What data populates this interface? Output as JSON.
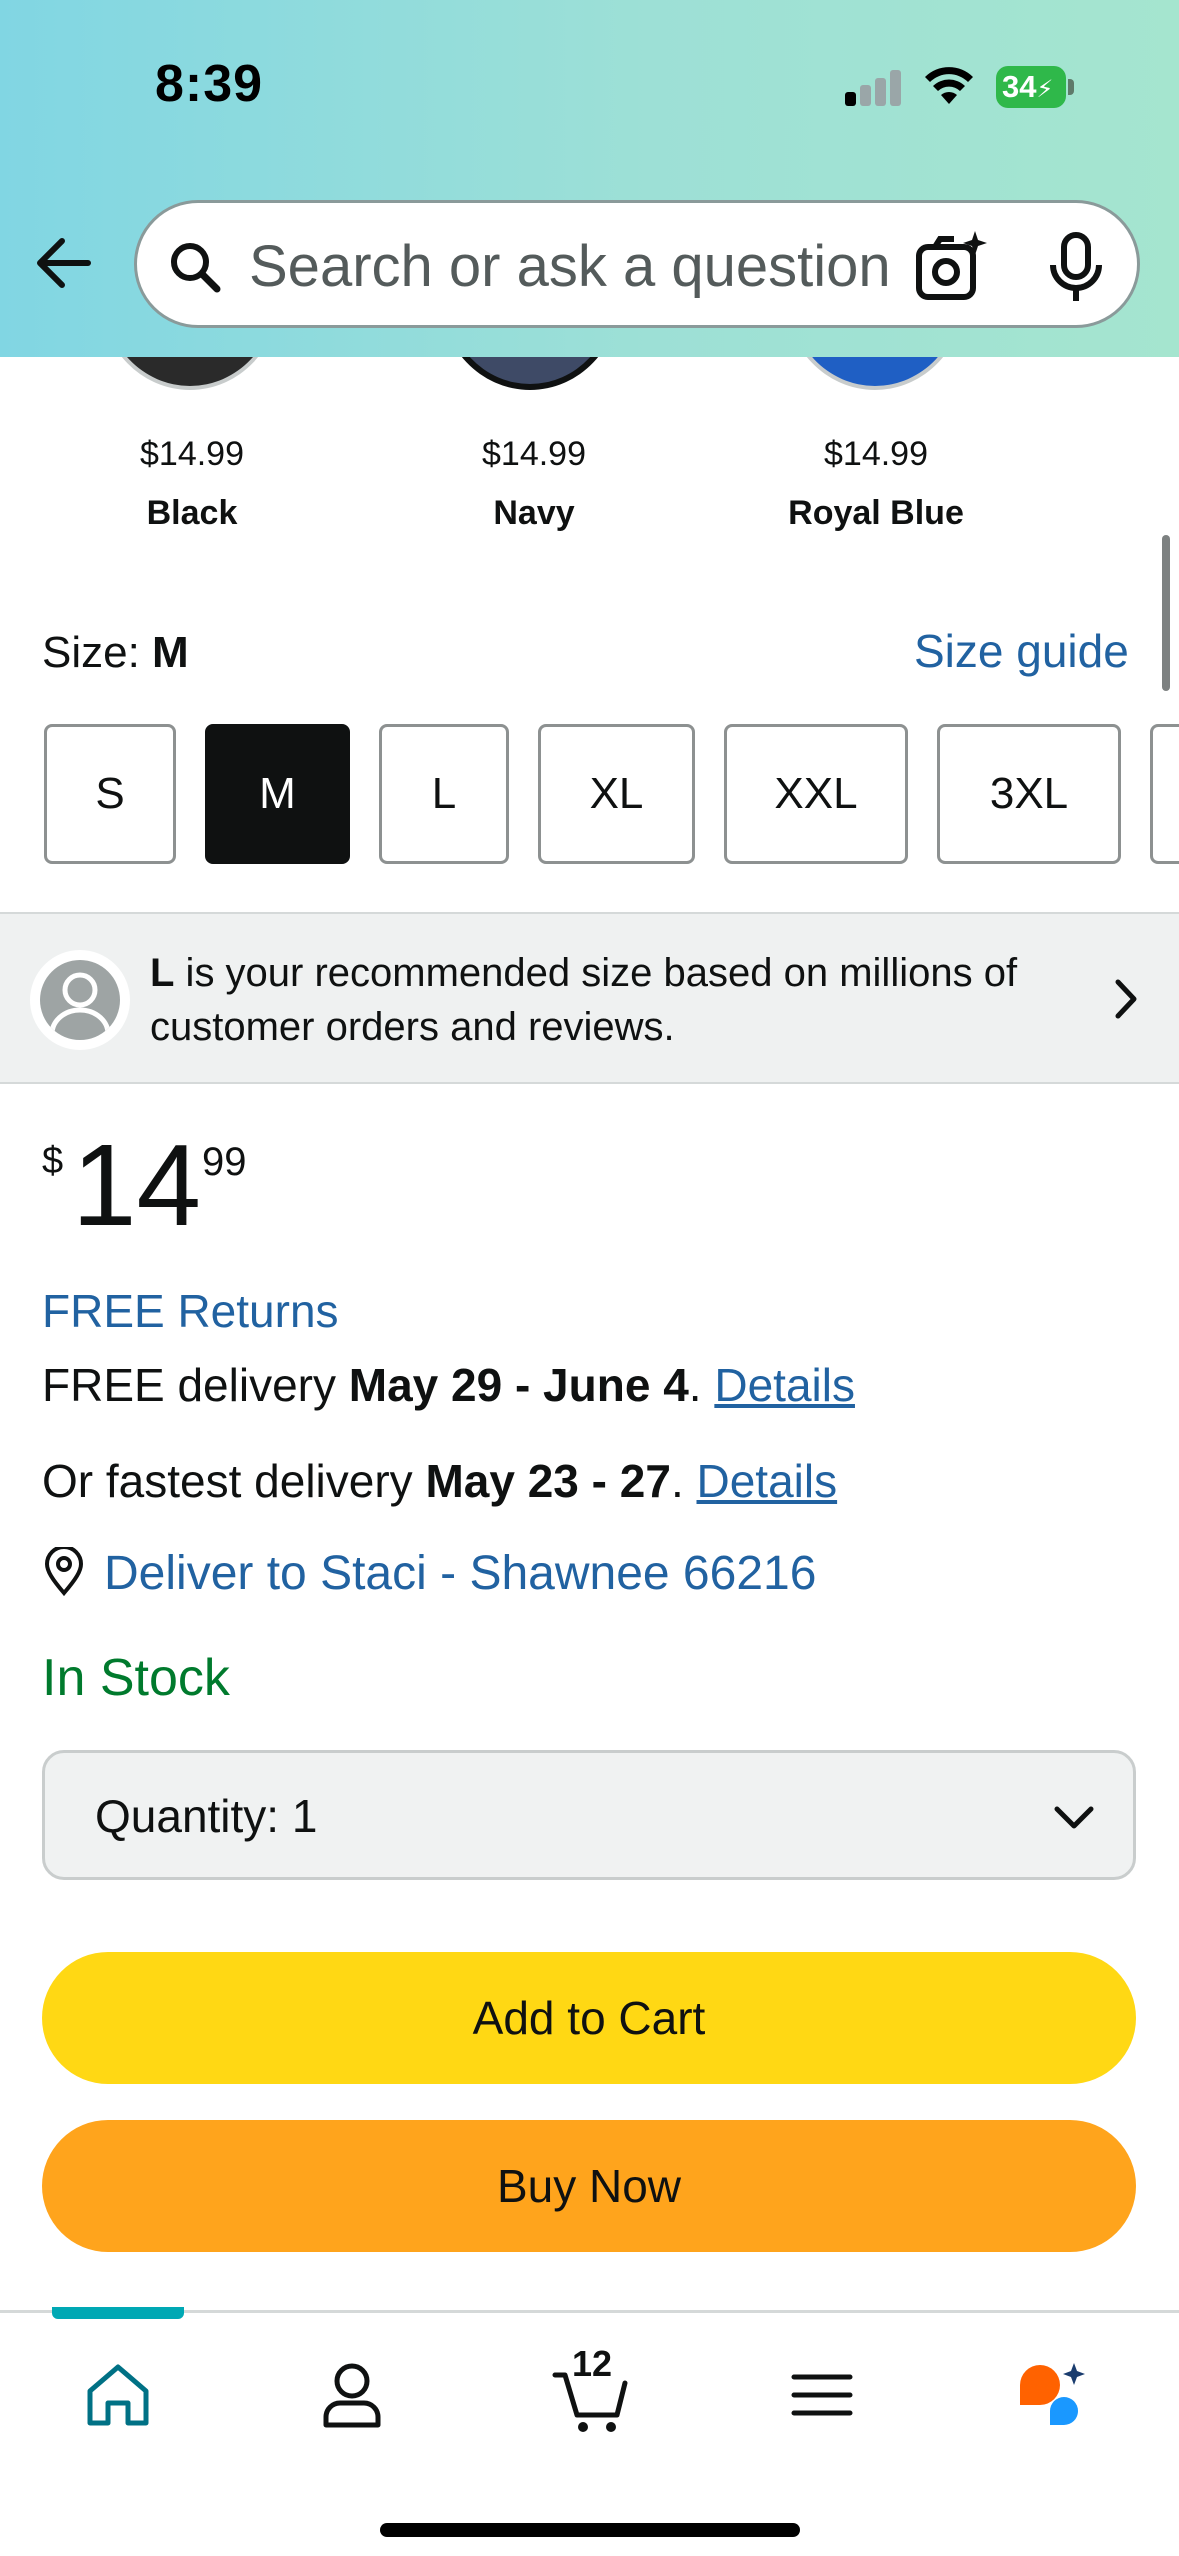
{
  "status_bar": {
    "time": "8:39",
    "battery": "34"
  },
  "header": {
    "search_placeholder": "Search or ask a question"
  },
  "colors": [
    {
      "price": "$14.99",
      "name": "Black",
      "swatch": "#2a2a2a"
    },
    {
      "price": "$14.99",
      "name": "Navy",
      "swatch": "#3e4a66"
    },
    {
      "price": "$14.99",
      "name": "Royal Blue",
      "swatch": "#1f5fc4"
    }
  ],
  "size": {
    "label": "Size: ",
    "selected": "M",
    "guide_link": "Size guide",
    "options": [
      "S",
      "M",
      "L",
      "XL",
      "XXL",
      "3XL"
    ]
  },
  "recommendation": {
    "size": "L",
    "text": " is your recommended size based on millions of customer orders and reviews."
  },
  "price": {
    "currency": "$",
    "whole": "14",
    "fraction": "99"
  },
  "delivery": {
    "free_returns": "FREE Returns",
    "standard_prefix": "FREE delivery ",
    "standard_dates": "May 29 - June 4",
    "standard_suffix": ". ",
    "details_1": "Details",
    "fastest_prefix": "Or fastest delivery ",
    "fastest_dates": "May 23 - 27",
    "fastest_suffix": ". ",
    "details_2": "Details",
    "deliver_to": "Deliver to Staci - Shawnee 66216",
    "stock": "In Stock"
  },
  "quantity": {
    "label": "Quantity:",
    "value": "1"
  },
  "buttons": {
    "add_to_cart": "Add to Cart",
    "buy_now": "Buy Now"
  },
  "bottom_nav": {
    "cart_count": "12"
  },
  "theme": {
    "link": "#2162a1",
    "stock": "#007a2d",
    "cart_button": "#ffd814",
    "buy_button": "#ffa41c",
    "nav_accent": "#00a8b4"
  }
}
